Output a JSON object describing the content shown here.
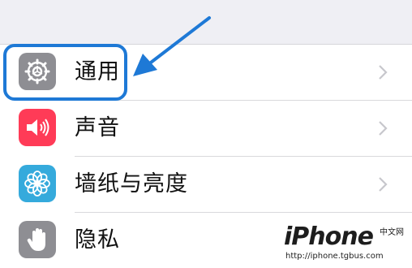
{
  "settings": {
    "items": [
      {
        "label": "通用",
        "icon": "gear-icon",
        "icon_bg": "#8e8e93"
      },
      {
        "label": "声音",
        "icon": "speaker-icon",
        "icon_bg": "#ff3b57"
      },
      {
        "label": "墙纸与亮度",
        "icon": "flower-icon",
        "icon_bg": "#35aadc"
      },
      {
        "label": "隐私",
        "icon": "hand-icon",
        "icon_bg": "#8e8e93"
      }
    ]
  },
  "annotation": {
    "highlight_color": "#1e79d6"
  },
  "watermark": {
    "logo": "iPhone",
    "cn": "中文网",
    "url": "http://iphone.tgbus.com"
  }
}
